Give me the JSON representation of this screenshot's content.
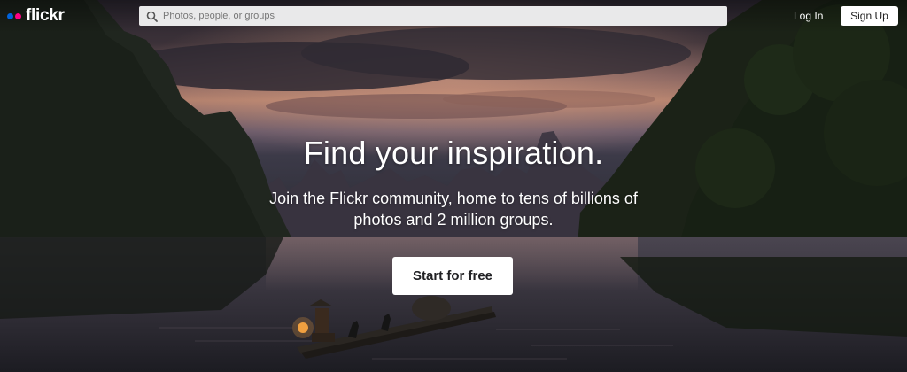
{
  "header": {
    "logo_text": "flickr",
    "search": {
      "placeholder": "Photos, people, or groups"
    },
    "login_label": "Log In",
    "signup_label": "Sign Up"
  },
  "hero": {
    "headline": "Find your inspiration.",
    "subline_1": "Join the Flickr community, home to tens of billions of",
    "subline_2": "photos and 2 million groups.",
    "cta_label": "Start for free"
  },
  "colors": {
    "brand_blue": "#0063dc",
    "brand_pink": "#ff0084"
  },
  "icons": [
    "search-icon"
  ]
}
